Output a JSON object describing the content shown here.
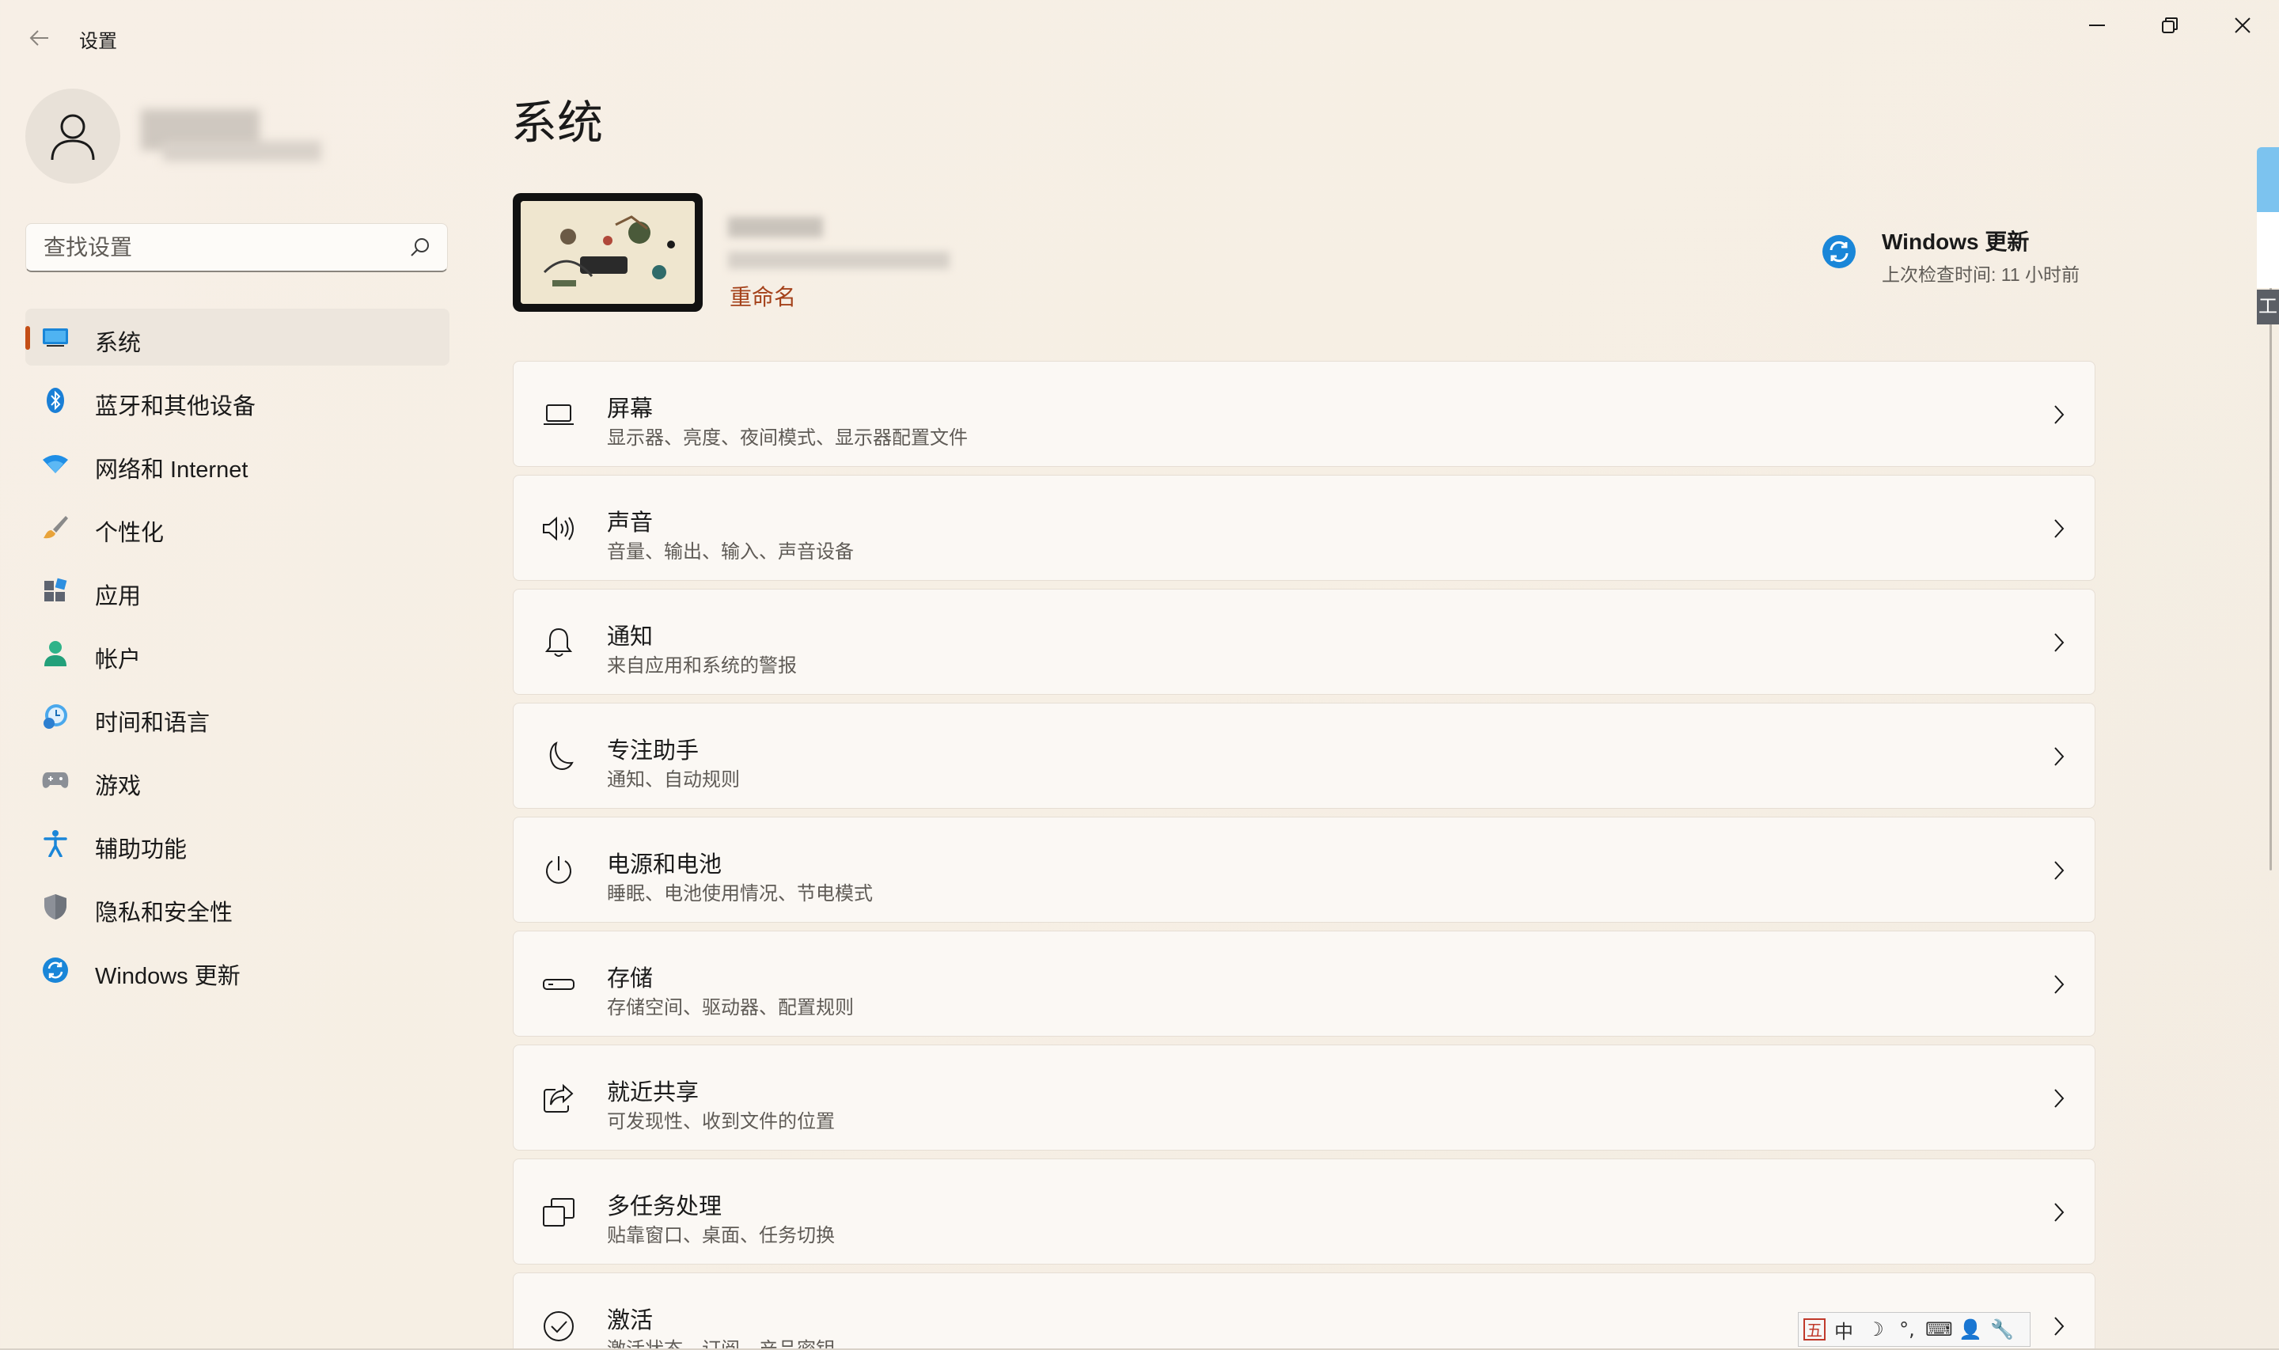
{
  "window": {
    "title": "设置",
    "controls": [
      "minimize",
      "restore",
      "close"
    ]
  },
  "search": {
    "placeholder": "查找设置",
    "value": ""
  },
  "sidebar": {
    "items": [
      {
        "label": "系统",
        "icon": "system-display-icon",
        "selected": true
      },
      {
        "label": "蓝牙和其他设备",
        "icon": "bluetooth-icon"
      },
      {
        "label": "网络和 Internet",
        "icon": "wifi-icon"
      },
      {
        "label": "个性化",
        "icon": "brush-icon"
      },
      {
        "label": "应用",
        "icon": "apps-icon"
      },
      {
        "label": "帐户",
        "icon": "account-icon"
      },
      {
        "label": "时间和语言",
        "icon": "clock-globe-icon"
      },
      {
        "label": "游戏",
        "icon": "gamepad-icon"
      },
      {
        "label": "辅助功能",
        "icon": "accessibility-icon"
      },
      {
        "label": "隐私和安全性",
        "icon": "shield-icon"
      },
      {
        "label": "Windows 更新",
        "icon": "windows-update-icon"
      }
    ]
  },
  "main": {
    "title": "系统",
    "device": {
      "rename_label": "重命名"
    },
    "windows_update": {
      "title": "Windows 更新",
      "subtitle": "上次检查时间: 11 小时前"
    },
    "cards": [
      {
        "title": "屏幕",
        "subtitle": "显示器、亮度、夜间模式、显示器配置文件",
        "icon": "laptop-icon"
      },
      {
        "title": "声音",
        "subtitle": "音量、输出、输入、声音设备",
        "icon": "speaker-icon"
      },
      {
        "title": "通知",
        "subtitle": "来自应用和系统的警报",
        "icon": "bell-icon"
      },
      {
        "title": "专注助手",
        "subtitle": "通知、自动规则",
        "icon": "moon-icon"
      },
      {
        "title": "电源和电池",
        "subtitle": "睡眠、电池使用情况、节电模式",
        "icon": "power-icon"
      },
      {
        "title": "存储",
        "subtitle": "存储空间、驱动器、配置规则",
        "icon": "storage-drive-icon"
      },
      {
        "title": "就近共享",
        "subtitle": "可发现性、收到文件的位置",
        "icon": "share-icon"
      },
      {
        "title": "多任务处理",
        "subtitle": "贴靠窗口、桌面、任务切换",
        "icon": "multitask-icon"
      },
      {
        "title": "激活",
        "subtitle": "激活状态、订阅、产品密钥",
        "icon": "check-circle-icon"
      }
    ]
  },
  "edge_panel": {
    "tab_text": "工"
  },
  "ime_toolbar": {
    "items": [
      "五",
      "中",
      "☽",
      "°,",
      "⌨",
      "👤",
      "🔧"
    ]
  },
  "colors": {
    "accent": "#c44e16",
    "link": "#a4411a",
    "update_blue": "#1a86d8"
  }
}
